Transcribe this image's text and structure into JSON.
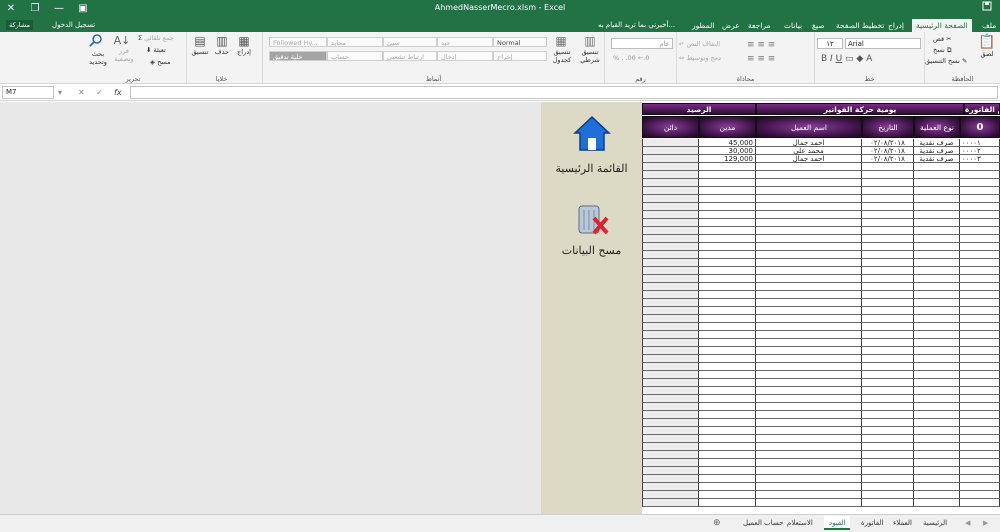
{
  "window": {
    "title": "AhmedNasserMecro.xlsm - Excel",
    "save_icon": "save-icon"
  },
  "ribbon_tabs": [
    "ملف",
    "الصفحة الرئيسية",
    "إدراج",
    "تخطيط الصفحة",
    "صيغ",
    "بيانات",
    "مراجعة",
    "عرض",
    "المطور"
  ],
  "active_tab": "الصفحة الرئيسية",
  "tell_me": "أخبرني بما تريد القيام به...",
  "sign_in": "تسجيل الدخول",
  "share": "مشاركة",
  "ribbon": {
    "clipboard": {
      "cut": "قص",
      "copy": "نسخ",
      "paint": "نسخ التنسيق",
      "paste": "لصق",
      "label": "الحافظة"
    },
    "font": {
      "name": "Arial",
      "size": "١٢",
      "label": "خط"
    },
    "alignment": {
      "wrap": "التفاف النص",
      "merge": "دمج وتوسيط",
      "label": "محاذاة"
    },
    "number": {
      "format": "عام",
      "label": "رقم"
    },
    "styles": {
      "conditional": "تنسيق شرطي",
      "as_table": "تنسيق كجدول",
      "boxes": [
        "Normal",
        "جيد",
        "سيئ",
        "محايد",
        "Followed Hy...",
        "إخراج",
        "إدخال",
        "ارتباط تشعبي",
        "حساب",
        "خلية تدقيق"
      ],
      "label": "أنماط"
    },
    "cells": {
      "insert": "إدراج",
      "delete": "حذف",
      "format": "تنسيق",
      "label": "خلايا"
    },
    "editing": {
      "autosum": "جمع تلقائي",
      "fill": "تعبئة",
      "clear": "مسح",
      "sort": "فرز وتصفية",
      "find": "بحث وتحديد",
      "label": "تحرير"
    }
  },
  "formula_bar": {
    "name_box": "M7",
    "fx": "fx",
    "value": ""
  },
  "side_panel": {
    "home_label": "القائمة الرئيسية",
    "home_icon": "home-icon",
    "clear_label": "مسح البيانات",
    "clear_icon": "recycle-bin-delete-icon"
  },
  "sheet": {
    "header_invoice": "رقم الفاتورة",
    "header_journal": "يومية حركة الفواتير",
    "header_balance": "الرصيد",
    "invoice_no": "0",
    "columns": [
      "نوع العملية",
      "التاريخ",
      "اسم العميل",
      "مدين",
      "دائن"
    ],
    "rows": [
      {
        "num": "٠٠٠٠١",
        "type": "صرف نقدية",
        "date": "٠٢/٠٨/٢٠١٨",
        "client": "احمد جمال",
        "debit": "45,000",
        "credit": ""
      },
      {
        "num": "٠٠٠٠٢",
        "type": "صرف نقدية",
        "date": "٠٢/٠٨/٢٠١٨",
        "client": "محمد علي",
        "debit": "30,000",
        "credit": ""
      },
      {
        "num": "٠٠٠٠٣",
        "type": "صرف نقدية",
        "date": "٠٢/٠٨/٢٠١٨",
        "client": "احمد جمال",
        "debit": "129,000",
        "credit": ""
      }
    ]
  },
  "sheet_tabs": [
    "الرئيسية",
    "العملاء",
    "الفاتورة",
    "القيود",
    "الاستعلام",
    "حساب العميل"
  ],
  "active_sheet": "القيود",
  "colors": {
    "excel_green": "#217346",
    "header_purple": "#5a1f66",
    "side_panel": "#dcd9c4"
  }
}
